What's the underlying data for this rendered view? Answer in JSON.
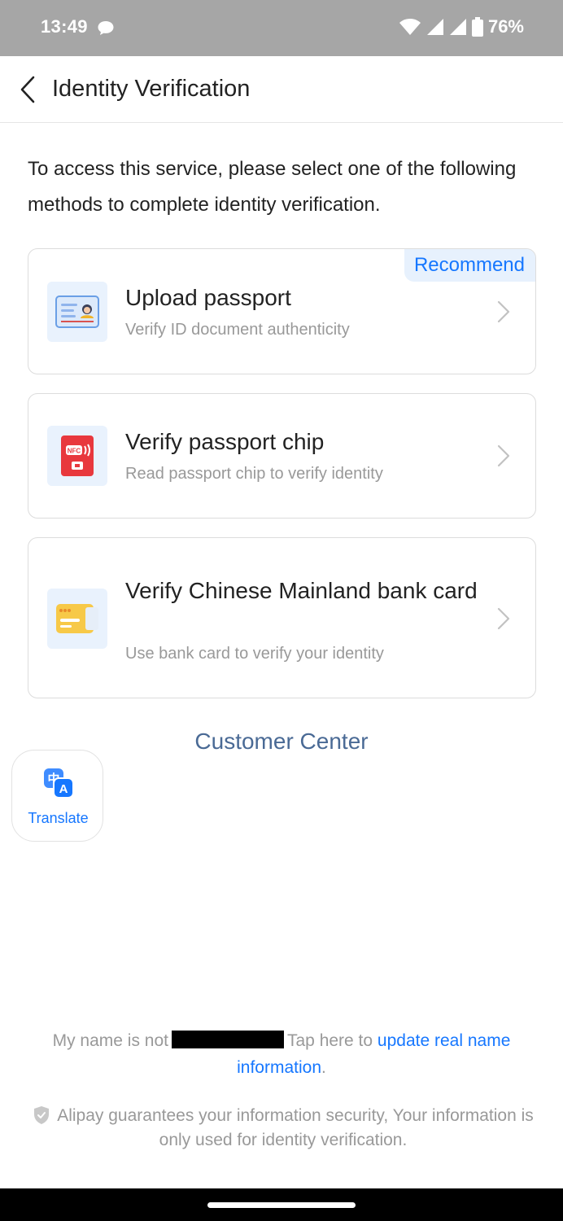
{
  "status_bar": {
    "time": "13:49",
    "battery_text": "76%",
    "icons": [
      "chat-bubble-icon",
      "wifi-icon",
      "signal-icon",
      "signal-icon",
      "battery-icon"
    ]
  },
  "header": {
    "title": "Identity Verification",
    "back_icon": "chevron-left-icon"
  },
  "intro": {
    "text": "To access this service, please select one of the following methods to complete identity verification."
  },
  "methods": [
    {
      "title": "Upload passport",
      "subtitle": "Verify ID document authenticity",
      "badge": "Recommend",
      "icon": "id-card-icon"
    },
    {
      "title": "Verify passport chip",
      "subtitle": "Read passport chip to verify identity",
      "icon": "nfc-chip-icon"
    },
    {
      "title": "Verify Chinese Mainland bank card",
      "subtitle": "Use bank card to verify your identity",
      "icon": "bank-card-icon"
    }
  ],
  "customer_center": {
    "label": "Customer Center"
  },
  "translate": {
    "label": "Translate",
    "icon": "translate-icon"
  },
  "name_note": {
    "prefix": "My name is not",
    "middle": "Tap here to",
    "link": "update real name information",
    "suffix": "."
  },
  "security_note": {
    "text": "Alipay guarantees your information security, Your information is only used for identity verification.",
    "icon": "shield-check-icon"
  },
  "colors": {
    "accent": "#1677ff",
    "status_bar": "#a6a6a6",
    "customer_center": "#4a6a95",
    "muted_text": "#999999"
  }
}
